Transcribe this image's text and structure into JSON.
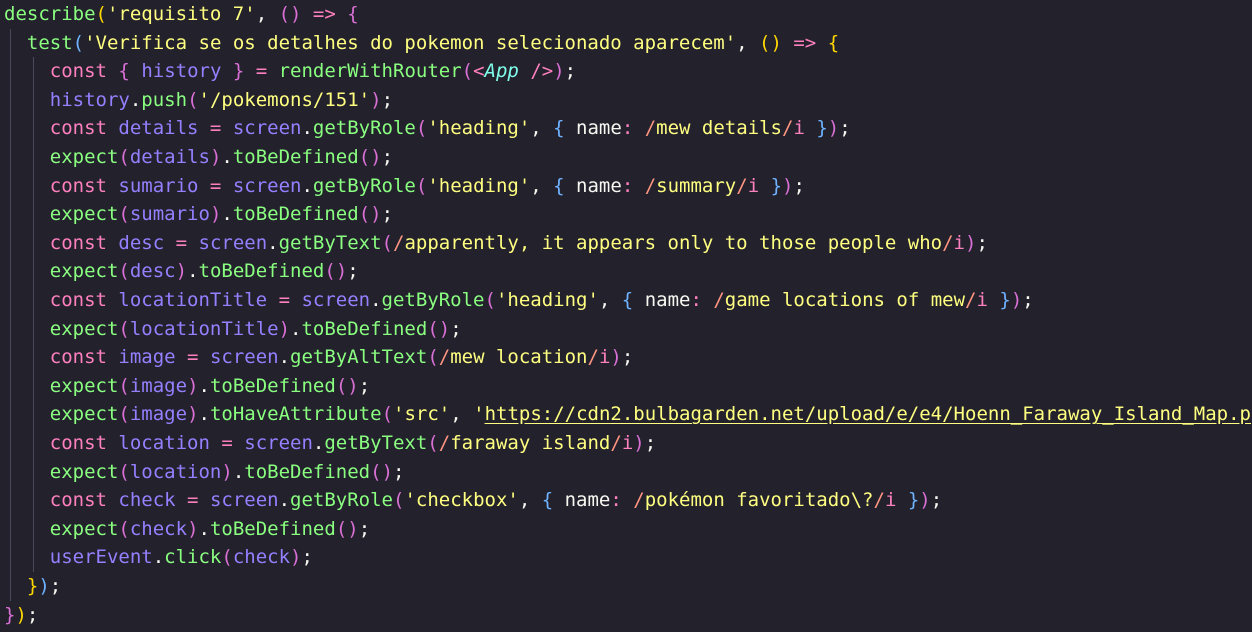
{
  "editor": {
    "lines": [
      {
        "indent": 0,
        "tokens": [
          {
            "t": "describe",
            "c": "f"
          },
          {
            "t": "(",
            "c": "b1"
          },
          {
            "t": "'requisito 7'",
            "c": "s"
          },
          {
            "t": ", ",
            "c": "p"
          },
          {
            "t": "()",
            "c": "b2"
          },
          {
            "t": " => ",
            "c": "k"
          },
          {
            "t": "{",
            "c": "b2"
          }
        ]
      },
      {
        "indent": 1,
        "tokens": [
          {
            "t": "test",
            "c": "f"
          },
          {
            "t": "(",
            "c": "b3"
          },
          {
            "t": "'Verifica se os detalhes do pokemon selecionado aparecem'",
            "c": "s"
          },
          {
            "t": ", ",
            "c": "p"
          },
          {
            "t": "()",
            "c": "b1"
          },
          {
            "t": " => ",
            "c": "k"
          },
          {
            "t": "{",
            "c": "b1"
          }
        ]
      },
      {
        "indent": 2,
        "tokens": [
          {
            "t": "const",
            "c": "k"
          },
          {
            "t": " ",
            "c": "p"
          },
          {
            "t": "{",
            "c": "b2"
          },
          {
            "t": " history ",
            "c": "v"
          },
          {
            "t": "}",
            "c": "b2"
          },
          {
            "t": " = ",
            "c": "k"
          },
          {
            "t": "renderWithRouter",
            "c": "f"
          },
          {
            "t": "(",
            "c": "b2"
          },
          {
            "t": "<",
            "c": "k"
          },
          {
            "t": "App",
            "c": "c"
          },
          {
            "t": " />",
            "c": "k"
          },
          {
            "t": ")",
            "c": "b2"
          },
          {
            "t": ";",
            "c": "p"
          }
        ]
      },
      {
        "indent": 2,
        "tokens": [
          {
            "t": "history",
            "c": "v"
          },
          {
            "t": ".",
            "c": "p"
          },
          {
            "t": "push",
            "c": "f"
          },
          {
            "t": "(",
            "c": "b2"
          },
          {
            "t": "'/pokemons/151'",
            "c": "s"
          },
          {
            "t": ")",
            "c": "b2"
          },
          {
            "t": ";",
            "c": "p"
          }
        ]
      },
      {
        "indent": 2,
        "tokens": [
          {
            "t": "const",
            "c": "k"
          },
          {
            "t": " details ",
            "c": "v"
          },
          {
            "t": "= ",
            "c": "k"
          },
          {
            "t": "screen",
            "c": "v"
          },
          {
            "t": ".",
            "c": "p"
          },
          {
            "t": "getByRole",
            "c": "f"
          },
          {
            "t": "(",
            "c": "b2"
          },
          {
            "t": "'heading'",
            "c": "s"
          },
          {
            "t": ", ",
            "c": "p"
          },
          {
            "t": "{",
            "c": "b3"
          },
          {
            "t": " name",
            "c": "pr"
          },
          {
            "t": ": ",
            "c": "k"
          },
          {
            "t": "/",
            "c": "r"
          },
          {
            "t": "mew details",
            "c": "rb"
          },
          {
            "t": "/",
            "c": "r"
          },
          {
            "t": "i ",
            "c": "k"
          },
          {
            "t": "}",
            "c": "b3"
          },
          {
            "t": ")",
            "c": "b2"
          },
          {
            "t": ";",
            "c": "p"
          }
        ]
      },
      {
        "indent": 2,
        "tokens": [
          {
            "t": "expect",
            "c": "f"
          },
          {
            "t": "(",
            "c": "b2"
          },
          {
            "t": "details",
            "c": "v"
          },
          {
            "t": ")",
            "c": "b2"
          },
          {
            "t": ".",
            "c": "p"
          },
          {
            "t": "toBeDefined",
            "c": "f"
          },
          {
            "t": "()",
            "c": "b2"
          },
          {
            "t": ";",
            "c": "p"
          }
        ]
      },
      {
        "indent": 2,
        "tokens": [
          {
            "t": "const",
            "c": "k"
          },
          {
            "t": " sumario ",
            "c": "v"
          },
          {
            "t": "= ",
            "c": "k"
          },
          {
            "t": "screen",
            "c": "v"
          },
          {
            "t": ".",
            "c": "p"
          },
          {
            "t": "getByRole",
            "c": "f"
          },
          {
            "t": "(",
            "c": "b2"
          },
          {
            "t": "'heading'",
            "c": "s"
          },
          {
            "t": ", ",
            "c": "p"
          },
          {
            "t": "{",
            "c": "b3"
          },
          {
            "t": " name",
            "c": "pr"
          },
          {
            "t": ": ",
            "c": "k"
          },
          {
            "t": "/",
            "c": "r"
          },
          {
            "t": "summary",
            "c": "rb"
          },
          {
            "t": "/",
            "c": "r"
          },
          {
            "t": "i ",
            "c": "k"
          },
          {
            "t": "}",
            "c": "b3"
          },
          {
            "t": ")",
            "c": "b2"
          },
          {
            "t": ";",
            "c": "p"
          }
        ]
      },
      {
        "indent": 2,
        "tokens": [
          {
            "t": "expect",
            "c": "f"
          },
          {
            "t": "(",
            "c": "b2"
          },
          {
            "t": "sumario",
            "c": "v"
          },
          {
            "t": ")",
            "c": "b2"
          },
          {
            "t": ".",
            "c": "p"
          },
          {
            "t": "toBeDefined",
            "c": "f"
          },
          {
            "t": "()",
            "c": "b2"
          },
          {
            "t": ";",
            "c": "p"
          }
        ]
      },
      {
        "indent": 2,
        "tokens": [
          {
            "t": "const",
            "c": "k"
          },
          {
            "t": " desc ",
            "c": "v"
          },
          {
            "t": "= ",
            "c": "k"
          },
          {
            "t": "screen",
            "c": "v"
          },
          {
            "t": ".",
            "c": "p"
          },
          {
            "t": "getByText",
            "c": "f"
          },
          {
            "t": "(",
            "c": "b2"
          },
          {
            "t": "/",
            "c": "r"
          },
          {
            "t": "apparently, it appears only to those people who",
            "c": "rb"
          },
          {
            "t": "/",
            "c": "r"
          },
          {
            "t": "i",
            "c": "k"
          },
          {
            "t": ")",
            "c": "b2"
          },
          {
            "t": ";",
            "c": "p"
          }
        ]
      },
      {
        "indent": 2,
        "tokens": [
          {
            "t": "expect",
            "c": "f"
          },
          {
            "t": "(",
            "c": "b2"
          },
          {
            "t": "desc",
            "c": "v"
          },
          {
            "t": ")",
            "c": "b2"
          },
          {
            "t": ".",
            "c": "p"
          },
          {
            "t": "toBeDefined",
            "c": "f"
          },
          {
            "t": "()",
            "c": "b2"
          },
          {
            "t": ";",
            "c": "p"
          }
        ]
      },
      {
        "indent": 2,
        "tokens": [
          {
            "t": "const",
            "c": "k"
          },
          {
            "t": " locationTitle ",
            "c": "v"
          },
          {
            "t": "= ",
            "c": "k"
          },
          {
            "t": "screen",
            "c": "v"
          },
          {
            "t": ".",
            "c": "p"
          },
          {
            "t": "getByRole",
            "c": "f"
          },
          {
            "t": "(",
            "c": "b2"
          },
          {
            "t": "'heading'",
            "c": "s"
          },
          {
            "t": ", ",
            "c": "p"
          },
          {
            "t": "{",
            "c": "b3"
          },
          {
            "t": " name",
            "c": "pr"
          },
          {
            "t": ": ",
            "c": "k"
          },
          {
            "t": "/",
            "c": "r"
          },
          {
            "t": "game locations of mew",
            "c": "rb"
          },
          {
            "t": "/",
            "c": "r"
          },
          {
            "t": "i ",
            "c": "k"
          },
          {
            "t": "}",
            "c": "b3"
          },
          {
            "t": ")",
            "c": "b2"
          },
          {
            "t": ";",
            "c": "p"
          }
        ]
      },
      {
        "indent": 2,
        "tokens": [
          {
            "t": "expect",
            "c": "f"
          },
          {
            "t": "(",
            "c": "b2"
          },
          {
            "t": "locationTitle",
            "c": "v"
          },
          {
            "t": ")",
            "c": "b2"
          },
          {
            "t": ".",
            "c": "p"
          },
          {
            "t": "toBeDefined",
            "c": "f"
          },
          {
            "t": "()",
            "c": "b2"
          },
          {
            "t": ";",
            "c": "p"
          }
        ]
      },
      {
        "indent": 2,
        "tokens": [
          {
            "t": "const",
            "c": "k"
          },
          {
            "t": " image ",
            "c": "v"
          },
          {
            "t": "= ",
            "c": "k"
          },
          {
            "t": "screen",
            "c": "v"
          },
          {
            "t": ".",
            "c": "p"
          },
          {
            "t": "getByAltText",
            "c": "f"
          },
          {
            "t": "(",
            "c": "b2"
          },
          {
            "t": "/",
            "c": "r"
          },
          {
            "t": "mew location",
            "c": "rb"
          },
          {
            "t": "/",
            "c": "r"
          },
          {
            "t": "i",
            "c": "k"
          },
          {
            "t": ")",
            "c": "b2"
          },
          {
            "t": ";",
            "c": "p"
          }
        ]
      },
      {
        "indent": 2,
        "tokens": [
          {
            "t": "expect",
            "c": "f"
          },
          {
            "t": "(",
            "c": "b2"
          },
          {
            "t": "image",
            "c": "v"
          },
          {
            "t": ")",
            "c": "b2"
          },
          {
            "t": ".",
            "c": "p"
          },
          {
            "t": "toBeDefined",
            "c": "f"
          },
          {
            "t": "()",
            "c": "b2"
          },
          {
            "t": ";",
            "c": "p"
          }
        ]
      },
      {
        "indent": 2,
        "tokens": [
          {
            "t": "expect",
            "c": "f"
          },
          {
            "t": "(",
            "c": "b2"
          },
          {
            "t": "image",
            "c": "v"
          },
          {
            "t": ")",
            "c": "b2"
          },
          {
            "t": ".",
            "c": "p"
          },
          {
            "t": "toHaveAttribute",
            "c": "f"
          },
          {
            "t": "(",
            "c": "b2"
          },
          {
            "t": "'src'",
            "c": "s"
          },
          {
            "t": ", ",
            "c": "p"
          },
          {
            "t": "'",
            "c": "s"
          },
          {
            "t": "https://cdn2.bulbagarden.net/upload/e/e4/Hoenn_Faraway_Island_Map.p",
            "c": "u"
          }
        ]
      },
      {
        "indent": 2,
        "tokens": [
          {
            "t": "const",
            "c": "k"
          },
          {
            "t": " location ",
            "c": "v"
          },
          {
            "t": "= ",
            "c": "k"
          },
          {
            "t": "screen",
            "c": "v"
          },
          {
            "t": ".",
            "c": "p"
          },
          {
            "t": "getByText",
            "c": "f"
          },
          {
            "t": "(",
            "c": "b2"
          },
          {
            "t": "/",
            "c": "r"
          },
          {
            "t": "faraway island",
            "c": "rb"
          },
          {
            "t": "/",
            "c": "r"
          },
          {
            "t": "i",
            "c": "k"
          },
          {
            "t": ")",
            "c": "b2"
          },
          {
            "t": ";",
            "c": "p"
          }
        ]
      },
      {
        "indent": 2,
        "tokens": [
          {
            "t": "expect",
            "c": "f"
          },
          {
            "t": "(",
            "c": "b2"
          },
          {
            "t": "location",
            "c": "v"
          },
          {
            "t": ")",
            "c": "b2"
          },
          {
            "t": ".",
            "c": "p"
          },
          {
            "t": "toBeDefined",
            "c": "f"
          },
          {
            "t": "()",
            "c": "b2"
          },
          {
            "t": ";",
            "c": "p"
          }
        ]
      },
      {
        "indent": 2,
        "tokens": [
          {
            "t": "const",
            "c": "k"
          },
          {
            "t": " check ",
            "c": "v"
          },
          {
            "t": "= ",
            "c": "k"
          },
          {
            "t": "screen",
            "c": "v"
          },
          {
            "t": ".",
            "c": "p"
          },
          {
            "t": "getByRole",
            "c": "f"
          },
          {
            "t": "(",
            "c": "b2"
          },
          {
            "t": "'checkbox'",
            "c": "s"
          },
          {
            "t": ", ",
            "c": "p"
          },
          {
            "t": "{",
            "c": "b3"
          },
          {
            "t": " name",
            "c": "pr"
          },
          {
            "t": ": ",
            "c": "k"
          },
          {
            "t": "/",
            "c": "r"
          },
          {
            "t": "pokémon favoritado\\?",
            "c": "rb"
          },
          {
            "t": "/",
            "c": "r"
          },
          {
            "t": "i ",
            "c": "k"
          },
          {
            "t": "}",
            "c": "b3"
          },
          {
            "t": ")",
            "c": "b2"
          },
          {
            "t": ";",
            "c": "p"
          }
        ]
      },
      {
        "indent": 2,
        "tokens": [
          {
            "t": "expect",
            "c": "f"
          },
          {
            "t": "(",
            "c": "b2"
          },
          {
            "t": "check",
            "c": "v"
          },
          {
            "t": ")",
            "c": "b2"
          },
          {
            "t": ".",
            "c": "p"
          },
          {
            "t": "toBeDefined",
            "c": "f"
          },
          {
            "t": "()",
            "c": "b2"
          },
          {
            "t": ";",
            "c": "p"
          }
        ]
      },
      {
        "indent": 2,
        "tokens": [
          {
            "t": "userEvent",
            "c": "v"
          },
          {
            "t": ".",
            "c": "p"
          },
          {
            "t": "click",
            "c": "f"
          },
          {
            "t": "(",
            "c": "b2"
          },
          {
            "t": "check",
            "c": "v"
          },
          {
            "t": ")",
            "c": "b2"
          },
          {
            "t": ";",
            "c": "p"
          }
        ]
      },
      {
        "indent": 1,
        "tokens": [
          {
            "t": "}",
            "c": "b1"
          },
          {
            "t": ")",
            "c": "b3"
          },
          {
            "t": ";",
            "c": "p"
          }
        ]
      },
      {
        "indent": 0,
        "tokens": [
          {
            "t": "}",
            "c": "b2"
          },
          {
            "t": ")",
            "c": "b1"
          },
          {
            "t": ";",
            "c": "p"
          }
        ]
      }
    ]
  },
  "theme": {
    "background": "#22212c",
    "indent_guide": "#4b4a5c"
  }
}
